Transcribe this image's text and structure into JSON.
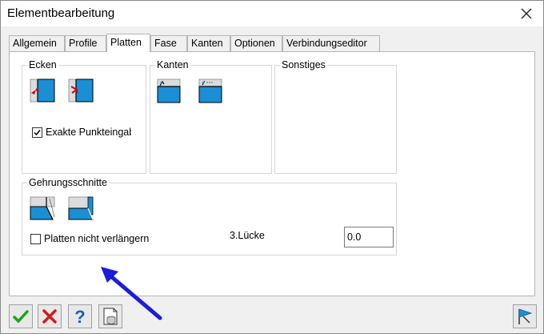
{
  "window": {
    "title": "Elementbearbeitung"
  },
  "tabs": [
    {
      "label": "Allgemein"
    },
    {
      "label": "Profile"
    },
    {
      "label": "Platten"
    },
    {
      "label": "Fase"
    },
    {
      "label": "Kanten"
    },
    {
      "label": "Optionen"
    },
    {
      "label": "Verbindungseditor"
    }
  ],
  "active_tab": "Platten",
  "groups": {
    "ecken": {
      "title": "Ecken",
      "checkbox_label": "Exakte Punkteingabe",
      "checkbox_checked": true
    },
    "kanten": {
      "title": "Kanten"
    },
    "sonstiges": {
      "title": "Sonstiges"
    },
    "gehrung": {
      "title": "Gehrungsschnitte",
      "checkbox_label": "Platten nicht verlängern",
      "checkbox_checked": false,
      "luecke_label": "3.Lücke",
      "luecke_value": "0.0"
    }
  },
  "colors": {
    "accent": "#1a8fd6",
    "arrow": "#1c1cdc",
    "ok_green": "#1aa51a",
    "cancel_red": "#d21a1a"
  },
  "icons": [
    "close-icon",
    "ok-check-icon",
    "cancel-x-icon",
    "help-question-icon",
    "document-db-icon",
    "flag-pointer-icon"
  ]
}
